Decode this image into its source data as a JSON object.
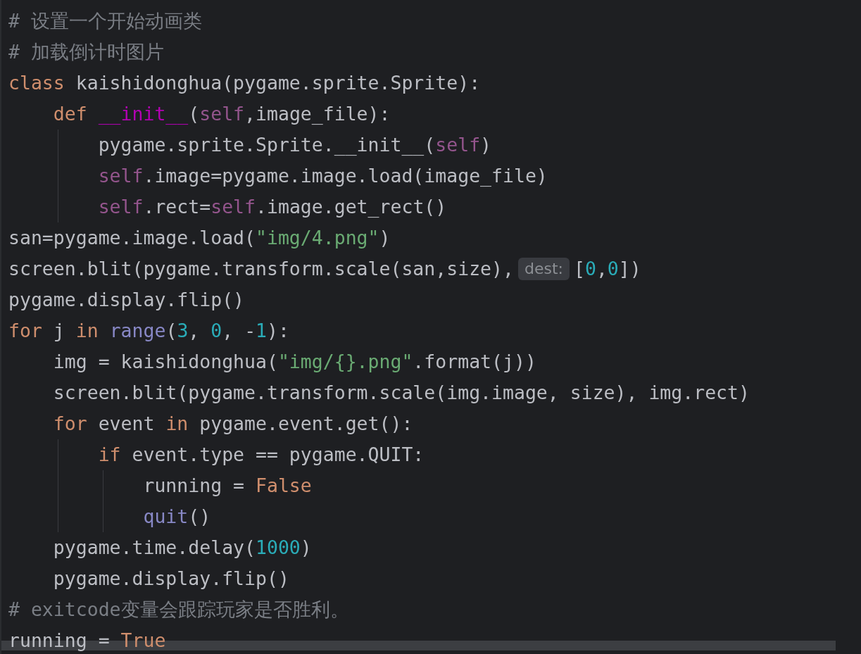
{
  "lines": [
    {
      "tokens": [
        {
          "text": "# 设置一个开始动画类",
          "kind": "comment"
        }
      ]
    },
    {
      "tokens": [
        {
          "text": "# 加载倒计时图片",
          "kind": "comment"
        }
      ]
    },
    {
      "tokens": [
        {
          "text": "class",
          "kind": "keyword"
        },
        {
          "text": " kaishidonghua(pygame.sprite.Sprite):",
          "kind": "plain"
        }
      ]
    },
    {
      "tokens": [
        {
          "text": "    def ",
          "kind": "keyword"
        },
        {
          "text": "__init__",
          "kind": "magic"
        },
        {
          "text": "(",
          "kind": "plain"
        },
        {
          "text": "self",
          "kind": "self"
        },
        {
          "text": ",image_file):",
          "kind": "plain"
        }
      ]
    },
    {
      "tokens": [
        {
          "text": "        pygame.sprite.Sprite.__init__(",
          "kind": "plain"
        },
        {
          "text": "self",
          "kind": "self"
        },
        {
          "text": ")",
          "kind": "plain"
        }
      ]
    },
    {
      "tokens": [
        {
          "text": "        self",
          "kind": "self"
        },
        {
          "text": ".image=pygame.image.load(image_file)",
          "kind": "plain"
        }
      ]
    },
    {
      "tokens": [
        {
          "text": "        self",
          "kind": "self"
        },
        {
          "text": ".rect=",
          "kind": "plain"
        },
        {
          "text": "self",
          "kind": "self"
        },
        {
          "text": ".image.get_rect()",
          "kind": "plain"
        }
      ]
    },
    {
      "tokens": [
        {
          "text": "san=pygame.image.load(",
          "kind": "plain"
        },
        {
          "text": "\"img/4.png\"",
          "kind": "string"
        },
        {
          "text": ")",
          "kind": "plain"
        }
      ]
    },
    {
      "tokens": [
        {
          "text": "screen.blit(pygame.transform.scale(san,size),",
          "kind": "plain"
        },
        {
          "text": "dest:",
          "kind": "hint"
        },
        {
          "text": "[",
          "kind": "plain"
        },
        {
          "text": "0",
          "kind": "number"
        },
        {
          "text": ",",
          "kind": "plain"
        },
        {
          "text": "0",
          "kind": "number"
        },
        {
          "text": "])",
          "kind": "plain"
        }
      ]
    },
    {
      "tokens": [
        {
          "text": "pygame.display.flip()",
          "kind": "plain"
        }
      ]
    },
    {
      "tokens": [
        {
          "text": "for",
          "kind": "keyword"
        },
        {
          "text": " j ",
          "kind": "plain"
        },
        {
          "text": "in ",
          "kind": "keyword"
        },
        {
          "text": "range",
          "kind": "builtin"
        },
        {
          "text": "(",
          "kind": "plain"
        },
        {
          "text": "3",
          "kind": "number"
        },
        {
          "text": ", ",
          "kind": "plain"
        },
        {
          "text": "0",
          "kind": "number"
        },
        {
          "text": ", -",
          "kind": "plain"
        },
        {
          "text": "1",
          "kind": "number"
        },
        {
          "text": "):",
          "kind": "plain"
        }
      ]
    },
    {
      "tokens": [
        {
          "text": "    img = kaishidonghua(",
          "kind": "plain"
        },
        {
          "text": "\"img/{}.png\"",
          "kind": "string"
        },
        {
          "text": ".format(j))",
          "kind": "plain"
        }
      ]
    },
    {
      "tokens": [
        {
          "text": "    screen.blit(pygame.transform.scale(img.image, size), img.rect)",
          "kind": "plain"
        }
      ]
    },
    {
      "tokens": [
        {
          "text": "    for",
          "kind": "keyword"
        },
        {
          "text": " event ",
          "kind": "plain"
        },
        {
          "text": "in",
          "kind": "keyword"
        },
        {
          "text": " pygame.event.get():",
          "kind": "plain"
        }
      ]
    },
    {
      "tokens": [
        {
          "text": "        if",
          "kind": "keyword"
        },
        {
          "text": " event.type == pygame.QUIT:",
          "kind": "plain"
        }
      ]
    },
    {
      "tokens": [
        {
          "text": "            running = ",
          "kind": "plain"
        },
        {
          "text": "False",
          "kind": "keyword"
        }
      ]
    },
    {
      "tokens": [
        {
          "text": "            quit",
          "kind": "builtin"
        },
        {
          "text": "()",
          "kind": "plain"
        }
      ]
    },
    {
      "tokens": [
        {
          "text": "    pygame.time.delay(",
          "kind": "plain"
        },
        {
          "text": "1000",
          "kind": "number"
        },
        {
          "text": ")",
          "kind": "plain"
        }
      ]
    },
    {
      "tokens": [
        {
          "text": "    pygame.display.flip()",
          "kind": "plain"
        }
      ]
    },
    {
      "tokens": [
        {
          "text": "# exitcode变量会跟踪玩家是否胜利。",
          "kind": "comment"
        }
      ]
    },
    {
      "tokens": [
        {
          "text": "running = ",
          "kind": "plain"
        },
        {
          "text": "True",
          "kind": "keyword"
        }
      ]
    }
  ]
}
